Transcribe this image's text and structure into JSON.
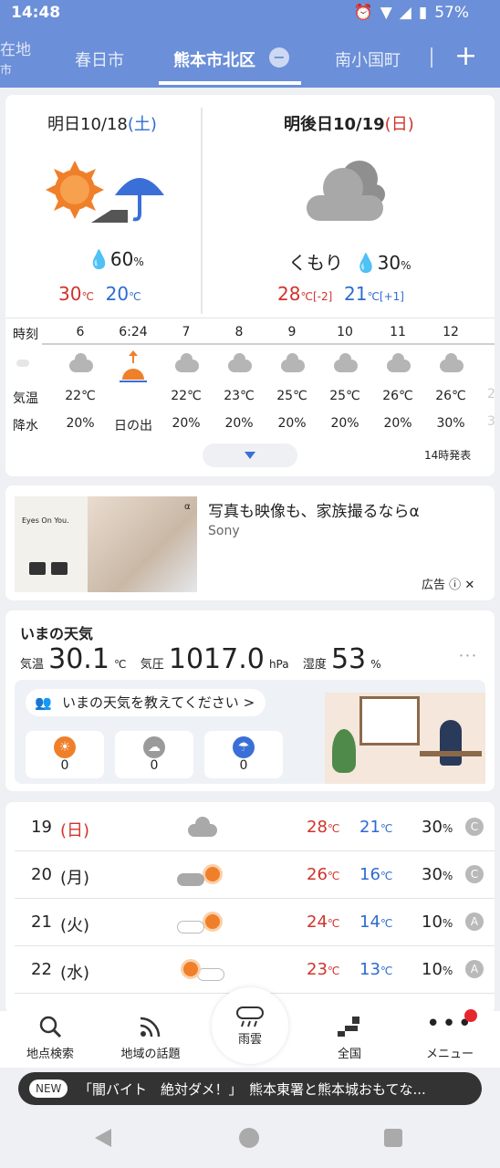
{
  "status": {
    "time": "14:48",
    "battery": "57%"
  },
  "tabs": {
    "left_partial_1": "在地",
    "left_partial_2": "市",
    "t1": "春日市",
    "t2": "熊本市北区",
    "t3": "南小国町",
    "remove": "−",
    "add": "+"
  },
  "forecast": {
    "tomorrow": {
      "date": "明日10/18",
      "dow": "(土)",
      "rain": "60",
      "rain_unit": "%",
      "high": "30",
      "low": "20",
      "unit": "℃"
    },
    "dayafter": {
      "date": "明後日10/19",
      "dow": "(日)",
      "weather": "くもり",
      "rain": "30",
      "rain_unit": "%",
      "high": "28",
      "high_diff": "[-2]",
      "low": "21",
      "low_diff": "[+1]",
      "unit": "℃"
    },
    "labels": {
      "time": "時刻",
      "temp": "気温",
      "precip": "降水"
    },
    "hours": [
      "6",
      "6:24",
      "7",
      "8",
      "9",
      "10",
      "11",
      "12"
    ],
    "temps": [
      "22℃",
      "日の出",
      "22℃",
      "23℃",
      "25℃",
      "25℃",
      "26℃",
      "26℃"
    ],
    "precips": [
      "20%",
      "",
      "20%",
      "20%",
      "20%",
      "20%",
      "20%",
      "30%"
    ],
    "sunrise_label": "日の出",
    "partial_temp": "2",
    "partial_precip": "3",
    "issued": "14時発表"
  },
  "ad": {
    "title": "写真も映像も、家族撮るならα",
    "sponsor": "Sony",
    "label": "広告",
    "img_text": "Eyes On You.",
    "img_small": "α"
  },
  "now": {
    "title": "いまの天気",
    "temp_label": "気温",
    "temp": "30.1",
    "temp_unit": "℃",
    "pres_label": "気圧",
    "pres": "1017.0",
    "pres_unit": "hPa",
    "hum_label": "湿度",
    "hum": "53",
    "hum_unit": "%",
    "prompt": "いまの天気を教えてください",
    "prompt_chev": ">",
    "votes": [
      "0",
      "0",
      "0"
    ],
    "more": "･･･"
  },
  "weekly": [
    {
      "day": "19",
      "dow": "(日)",
      "high": "28",
      "low": "21",
      "rain": "30",
      "badge": "C"
    },
    {
      "day": "20",
      "dow": "(月)",
      "high": "26",
      "low": "16",
      "rain": "30",
      "badge": "C"
    },
    {
      "day": "21",
      "dow": "(火)",
      "high": "24",
      "low": "14",
      "rain": "10",
      "badge": "A"
    },
    {
      "day": "22",
      "dow": "(水)",
      "high": "23",
      "low": "13",
      "rain": "10",
      "badge": "A"
    }
  ],
  "units": {
    "c": "℃",
    "pct": "%"
  },
  "nav": {
    "search": "地点検索",
    "topics": "地域の話題",
    "radar": "雨雲",
    "national": "全国",
    "menu": "メニュー"
  },
  "news": {
    "badge": "NEW",
    "text": "「闇バイト　絶対ダメ！」　熊本東署と熊本城おもてな..."
  },
  "colors": {
    "header": "#6b8fd8",
    "red": "#d0332a",
    "blue": "#2e6bd1",
    "sun": "#f07f2a"
  }
}
